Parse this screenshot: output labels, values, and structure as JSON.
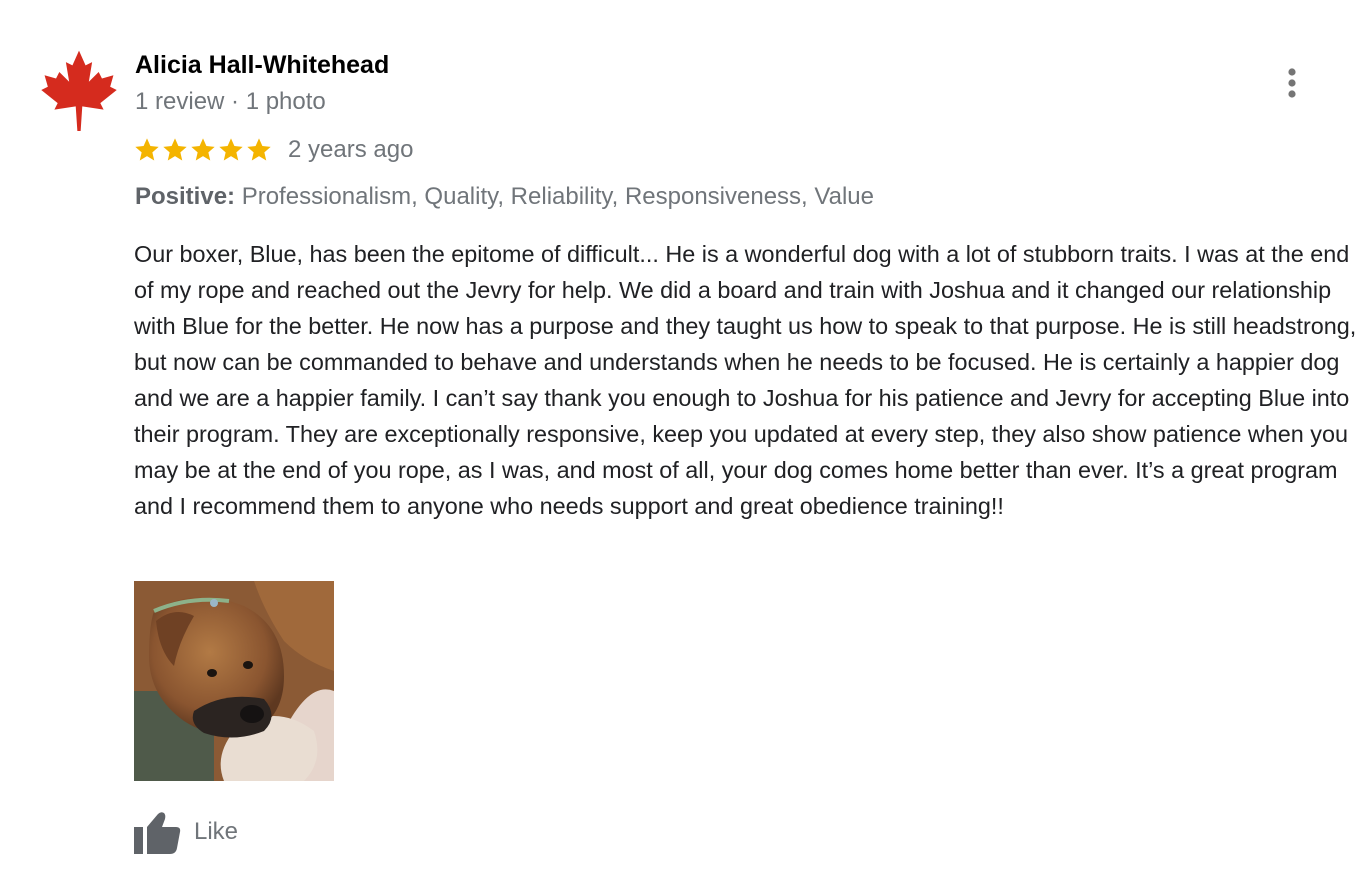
{
  "review": {
    "author": {
      "name": "Alicia Hall-Whitehead",
      "meta": "1 review · 1 photo",
      "avatar_icon": "maple-leaf-icon"
    },
    "menu_icon": "more-vertical-icon",
    "rating": {
      "stars": 5,
      "max": 5,
      "color": "#f4b400",
      "date": "2 years ago"
    },
    "highlights": {
      "label": "Positive:",
      "items": "Professionalism, Quality, Reliability, Responsiveness, Value"
    },
    "text": "Our boxer, Blue, has been the epitome of difficult... He is a wonderful dog with a lot of stubborn traits. I was at the end of my rope and reached out the Jevry for help. We did a board and train with Joshua and it changed our relationship with Blue for the better. He now has a purpose and they taught us how to speak to that purpose. He is still headstrong, but now can be commanded to behave and understands when he needs to be focused. He is certainly a happier dog and we are a happier family. I can’t say thank you enough to Joshua for his patience and Jevry for accepting Blue into their program. They are exceptionally responsive, keep you updated at every step, they also show patience when you may be at the end of you rope, as I was, and most of all, your dog comes home better than ever. It’s a great program and I recommend them to anyone who needs support and great obedience training!!",
    "photo": {
      "icon": "boxer-dog-photo"
    },
    "like": {
      "label": "Like",
      "icon": "thumbs-up-icon"
    }
  },
  "colors": {
    "avatar_red": "#d52b1e",
    "star_gold": "#f4b400",
    "secondary_text": "#70757a",
    "body_text": "#202124"
  }
}
